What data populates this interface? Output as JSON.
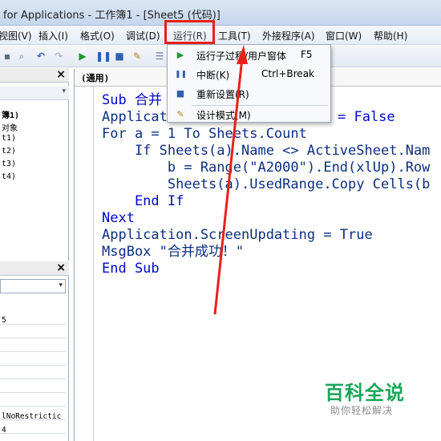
{
  "window": {
    "title": "for Applications - 工作簿1 - [Sheet5 (代码)]"
  },
  "menubar": {
    "items": [
      "视图(V)",
      "插入(I)",
      "格式(O)",
      "调试(D)",
      "运行(R)",
      "工具(T)",
      "外接程序(A)",
      "窗口(W)",
      "帮助(H)"
    ]
  },
  "toolbar": {
    "icons": [
      "save-icon",
      "undo-icon",
      "redo-icon",
      "run-icon",
      "pause-icon",
      "stop-icon",
      "design-mode-icon",
      "project-explorer-icon"
    ]
  },
  "project_panel": {
    "close": "×",
    "lines": [
      "簿1)",
      "对象",
      "t1)",
      "t2)",
      "t3)",
      "t4)"
    ]
  },
  "properties_panel": {
    "close": "×",
    "lines": [
      "5",
      "lNoRestrictic",
      "4"
    ]
  },
  "code_window": {
    "object_combo": "(通用)",
    "lines": [
      "Sub 合并",
      "Applicat",
      "For a = 1 To Sheets.Count",
      "    If Sheets(a).Name <> ActiveSheet.Nam",
      "        b = Range(\"A2000\").End(xlUp).Row",
      "        Sheets(a).UsedRange.Copy Cells(b",
      "    End If",
      "Next",
      "Application.ScreenUpdating = True",
      "MsgBox \"合并成功！\"",
      "End Sub"
    ],
    "line1_tail": "= False"
  },
  "run_menu": {
    "items": [
      {
        "icon": "run-icon",
        "label": "运行子过程/用户窗体",
        "shortcut": "F5"
      },
      {
        "icon": "pause-icon",
        "label": "中断(K)",
        "shortcut": "Ctrl+Break"
      },
      {
        "icon": "stop-icon",
        "label": "重新设置(R)",
        "shortcut": ""
      },
      {
        "icon": "design-mode-icon",
        "label": "设计模式(M)",
        "shortcut": ""
      }
    ]
  },
  "annotation": {
    "color": "#e8201a"
  },
  "watermark": {
    "logo": "百科全说",
    "sub": "助你轻松解决"
  },
  "colors": {
    "keyword": "#0008c8",
    "code_text": "#0c2f7e",
    "highlight": "#e8201a",
    "watermark": "#1aa65a"
  }
}
